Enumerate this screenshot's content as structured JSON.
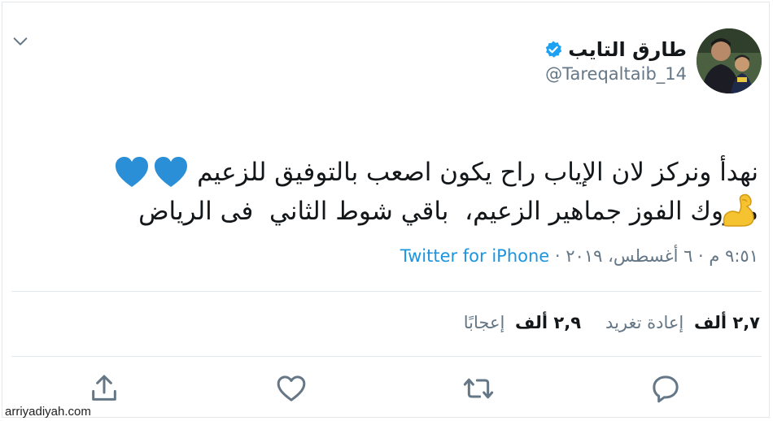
{
  "tweet": {
    "display_name": "طارق التايب",
    "handle": "@Tareqaltaib_14",
    "text_line1": "مبروك الفوز جماهير الزعيم،  باقي شوط الثاني  فى الرياض",
    "text_line2": "نهدأ ونركز لان الإياب راح يكون اصعب بالتوفيق للزعيم",
    "emojis": [
      "blue-heart",
      "blue-heart",
      "flexed-biceps"
    ],
    "timestamp": "٩:٥١ م · ٦ أغسطس، ٢٠١٩ ·",
    "source": "Twitter for iPhone"
  },
  "stats": {
    "retweets_count": "٢,٧ ألف",
    "retweets_label": "إعادة تغريد",
    "likes_count": "٢,٩ ألف",
    "likes_label": "إعجابًا"
  },
  "icons": {
    "menu": "chevron-down-icon",
    "verified": "verified-badge-icon",
    "reply": "reply-icon",
    "retweet": "retweet-icon",
    "like": "heart-icon",
    "share": "share-icon"
  },
  "colors": {
    "text": "#14171a",
    "secondary": "#657786",
    "link": "#1b95e0",
    "verified": "#1da1f2",
    "heart_emoji": "#2a8fd6",
    "biceps_emoji": "#f5c230"
  },
  "watermark": "arriyadiyah.com"
}
